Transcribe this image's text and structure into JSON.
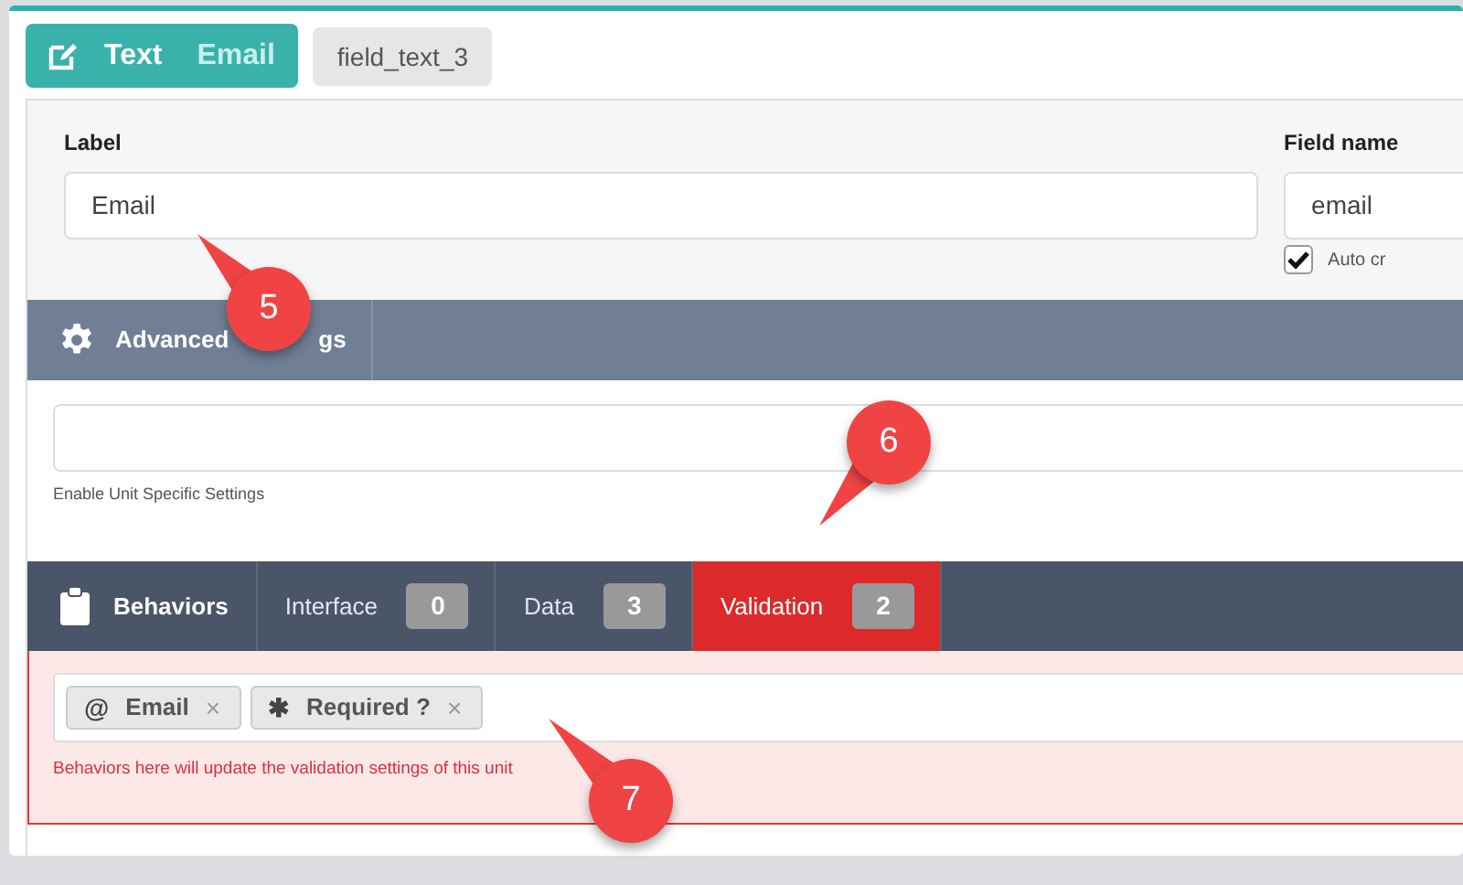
{
  "header": {
    "type_badge": {
      "type": "Text",
      "label": "Email"
    },
    "field_id": "field_text_3"
  },
  "basic": {
    "label": {
      "caption": "Label",
      "value": "Email"
    },
    "field_name": {
      "caption": "Field name",
      "value": "email"
    },
    "auto_create": {
      "label": "Auto cr",
      "checked": true
    }
  },
  "advanced": {
    "title": "Advanced",
    "title_tail": "gs",
    "help": "Enable Unit Specific Settings"
  },
  "behaviors": {
    "title": "Behaviors",
    "tabs": [
      {
        "label": "Interface",
        "count": "0",
        "selected": false
      },
      {
        "label": "Data",
        "count": "3",
        "selected": false
      },
      {
        "label": "Validation",
        "count": "2",
        "selected": true
      }
    ],
    "tags": [
      {
        "symbol": "@",
        "label": "Email",
        "remove": "×"
      },
      {
        "symbol": "✱",
        "label": "Required ?",
        "remove": "×"
      }
    ],
    "help": "Behaviors here will update the validation settings of this unit"
  },
  "callouts": [
    {
      "number": "5"
    },
    {
      "number": "6"
    },
    {
      "number": "7"
    }
  ]
}
